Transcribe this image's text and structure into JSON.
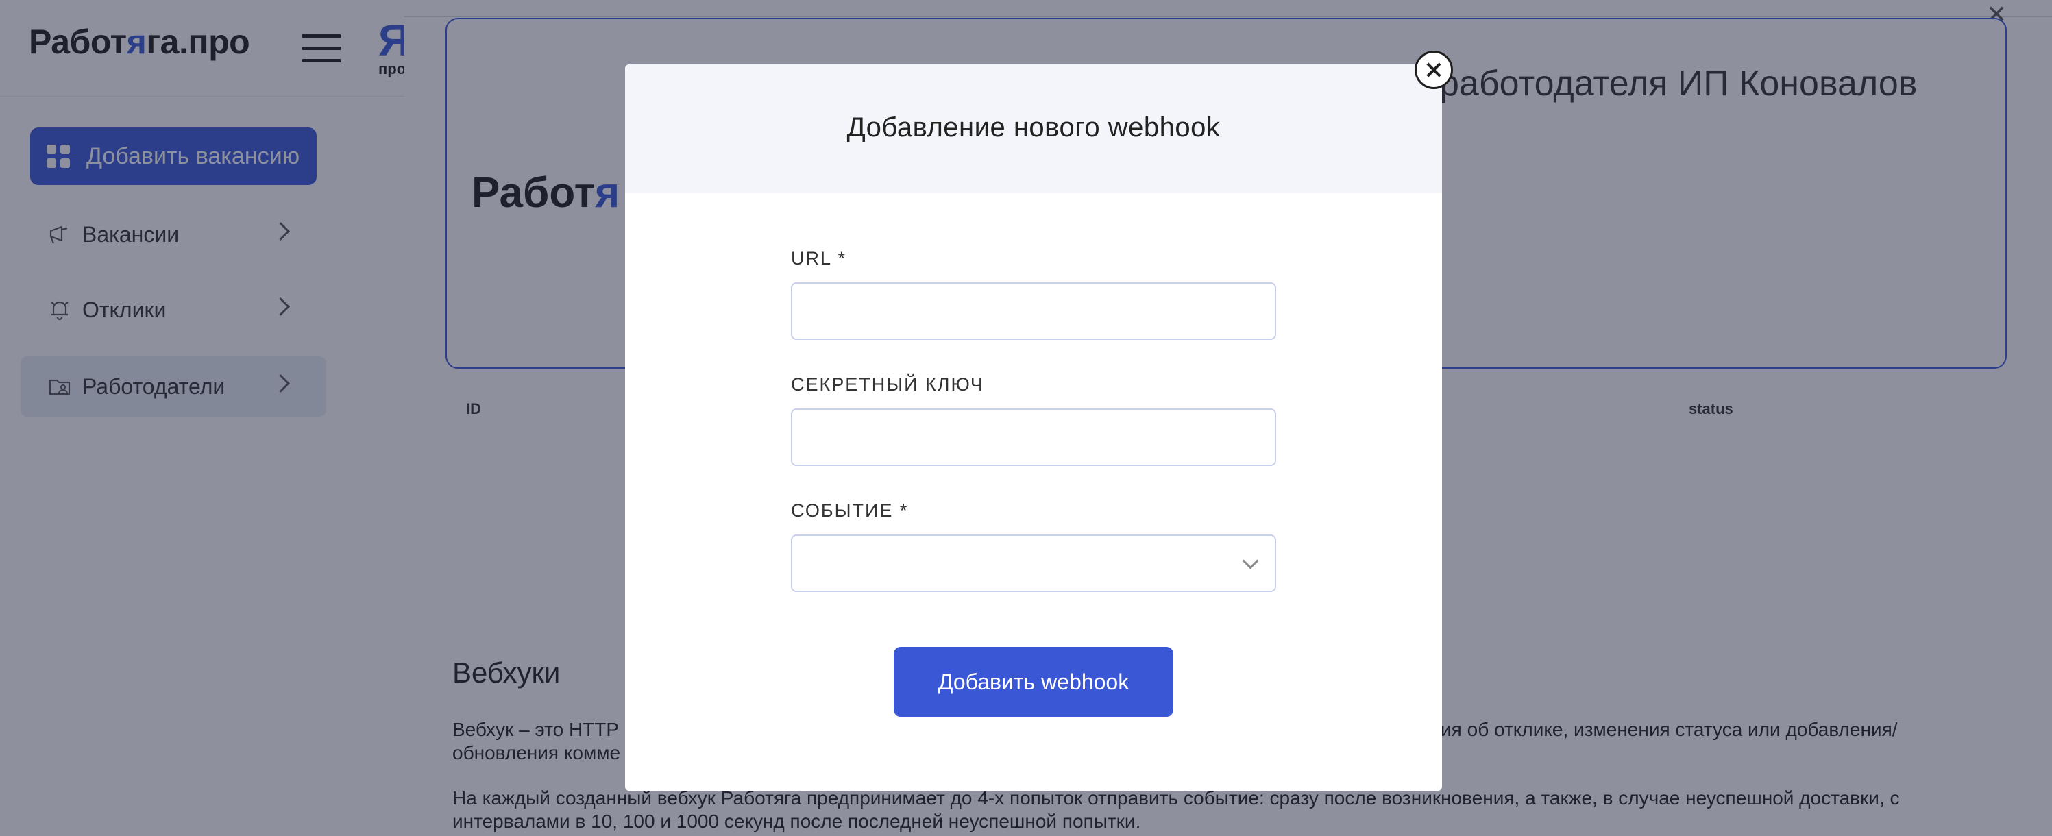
{
  "sidebar": {
    "logo_prefix": "Работ",
    "logo_accent": "я",
    "logo_suffix": "га.про",
    "ya_mark": "Я",
    "ya_sub": "про",
    "add_vacancy_label": "Добавить вакансию",
    "items": [
      {
        "label": "Вакансии",
        "icon": "megaphone-icon"
      },
      {
        "label": "Отклики",
        "icon": "bell-icon"
      },
      {
        "label": "Работодатели",
        "icon": "employer-folder-icon",
        "active": true
      }
    ]
  },
  "main": {
    "card_logo_prefix": "Работ",
    "card_logo_accent": "я",
    "card_title": "работодателя ИП Коновалов",
    "table_headers": {
      "id": "ID",
      "status": "status"
    },
    "webhooks_heading": "Вебхуки",
    "paragraph1_left": "Вебхук – это HTTP",
    "paragraph1_right": "ция об отклике, изменения статуса или добавления/",
    "paragraph1_line2": "обновления комме",
    "paragraph2": "На каждый созданный вебхук Работяга предпринимает до 4-х попыток отправить событие: сразу после возникновения, а также, в случае неуспешной доставки, с интервалами в 10, 100 и 1000 секунд после последней неуспешной попытки."
  },
  "modal": {
    "title": "Добавление нового webhook",
    "url_label": "URL *",
    "url_value": "",
    "secret_label": "СЕКРЕТНЫЙ КЛЮЧ",
    "secret_value": "",
    "event_label": "СОБЫТИЕ *",
    "event_value": "",
    "submit_label": "Добавить webhook"
  },
  "colors": {
    "accent": "#3a57d6",
    "overlay": "rgba(30,36,60,0.5)",
    "input_border": "#c9d0ec"
  }
}
